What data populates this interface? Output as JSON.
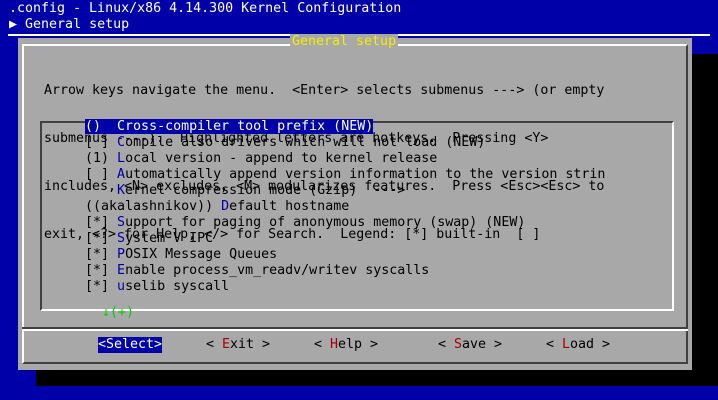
{
  "header": {
    "title": ".config - Linux/x86 4.14.300 Kernel Configuration",
    "breadcrumb_marker": "▶",
    "breadcrumb": "General setup"
  },
  "dialog": {
    "title": "General setup",
    "help_lines": [
      "Arrow keys navigate the menu.  <Enter> selects submenus ---> (or empty",
      "submenus ----).  Highlighted letters are hotkeys.  Pressing <Y>",
      "includes, <N> excludes, <M> modularizes features.  Press <Esc><Esc> to",
      "exit, <?> for Help, </> for Search.  Legend: [*] built-in  [ ]"
    ],
    "menu": [
      {
        "prefix": "()",
        "gap": "  ",
        "hot": "C",
        "rest": "ross-compiler tool prefix (NEW)",
        "selected": true
      },
      {
        "prefix": "[ ]",
        "gap": " ",
        "hot": "C",
        "rest": "ompile also drivers which will not load (NEW)",
        "selected": false
      },
      {
        "prefix": "(1)",
        "gap": " ",
        "hot": "L",
        "rest": "ocal version - append to kernel release",
        "selected": false
      },
      {
        "prefix": "[ ]",
        "gap": " ",
        "hot": "A",
        "rest": "utomatically append version information to the version strin",
        "selected": false
      },
      {
        "prefix": "",
        "gap": "    ",
        "hot": "K",
        "rest": "ernel compression mode (Gzip)  --->",
        "selected": false
      },
      {
        "prefix": "((akalashnikov))",
        "gap": " ",
        "hot": "D",
        "rest": "efault hostname",
        "selected": false
      },
      {
        "prefix": "[*]",
        "gap": " ",
        "hot": "S",
        "rest": "upport for paging of anonymous memory (swap) (NEW)",
        "selected": false
      },
      {
        "prefix": "[*]",
        "gap": " ",
        "hot": "S",
        "rest": "ystem V IPC",
        "selected": false
      },
      {
        "prefix": "[*]",
        "gap": " ",
        "hot": "P",
        "rest": "OSIX Message Queues",
        "selected": false
      },
      {
        "prefix": "[*]",
        "gap": " ",
        "hot": "E",
        "rest": "nable process_vm_readv/writev syscalls",
        "selected": false
      },
      {
        "prefix": "[*]",
        "gap": " ",
        "hot": "u",
        "rest": "selib syscall",
        "selected": false
      }
    ],
    "more_indicator": "↓(+)",
    "buttons": {
      "select": {
        "pre": "<",
        "hot": "S",
        "post": "elect>"
      },
      "exit": {
        "pre": "< ",
        "hot": "E",
        "post": "xit >"
      },
      "help": {
        "pre": "< ",
        "hot": "H",
        "post": "elp >"
      },
      "save": {
        "pre": "< ",
        "hot": "S",
        "post": "ave >"
      },
      "load": {
        "pre": "< ",
        "hot": "L",
        "post": "oad >"
      }
    }
  }
}
